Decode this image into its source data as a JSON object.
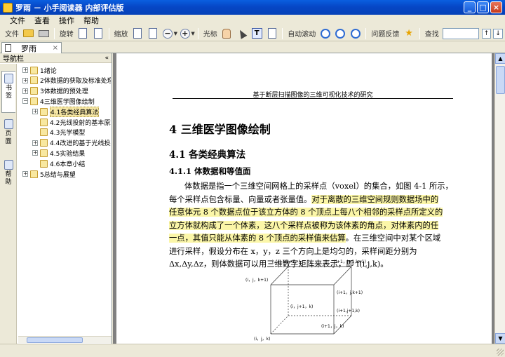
{
  "window": {
    "title": "罗雨 － 小手阅读器 内部评估版",
    "minimize": "_",
    "maximize": "□",
    "close": "×"
  },
  "menu": [
    "文件",
    "查看",
    "操作",
    "帮助"
  ],
  "toolbar": {
    "file_label": "文件",
    "rotate_label": "旋转",
    "zoom_label": "缩放",
    "zoom_out": "−",
    "zoom_in": "+",
    "cursor_label": "光标",
    "text_tool": "T",
    "autoscroll_label": "自动滚动",
    "feedback_label": "问题反馈",
    "find_label": "查找",
    "find_value": "",
    "find_prev": "↑",
    "find_next": "↓"
  },
  "doc_tab": {
    "label": "罗雨",
    "close": "×"
  },
  "sidebar": {
    "title": "导航栏",
    "collapse": "«",
    "vtabs": [
      "书签",
      "页面",
      "帮助"
    ],
    "tree": [
      {
        "label": "1绪论",
        "level": 0,
        "expander": "+"
      },
      {
        "label": "2体数据的获取及标准处理",
        "level": 0,
        "expander": "+"
      },
      {
        "label": "3体数据的预处理",
        "level": 0,
        "expander": "+"
      },
      {
        "label": "4三维医学图像绘制",
        "level": 0,
        "expander": "−"
      },
      {
        "label": "4.1各类经典算法",
        "level": 1,
        "expander": "+",
        "selected": true
      },
      {
        "label": "4.2光线投射的基本原理",
        "level": 1,
        "expander": ""
      },
      {
        "label": "4.3光学模型",
        "level": 1,
        "expander": ""
      },
      {
        "label": "4.4改进的基于光线投射的",
        "level": 1,
        "expander": "+"
      },
      {
        "label": "4.5实验结果",
        "level": 1,
        "expander": "+"
      },
      {
        "label": "4.6本章小结",
        "level": 1,
        "expander": ""
      },
      {
        "label": "5总结与展望",
        "level": 0,
        "expander": "+"
      }
    ]
  },
  "document": {
    "running_head": "基于断层扫描图像的三维可视化技术的研究",
    "chapter_title": "4 三维医学图像绘制",
    "section_title": "4.1 各类经典算法",
    "subsection_title": "4.1.1 体数据和等值面",
    "lines": [
      [
        {
          "t": "体数据是指一个三维空间网格上的采样点（voxel）的集合，如图 4-1 所示，",
          "hl": false
        }
      ],
      [
        {
          "t": "每个采样点包含标量、向量或者张量值。",
          "hl": false
        },
        {
          "t": "对于离散的三维空间规则数据场中的",
          "hl": true
        }
      ],
      [
        {
          "t": "任意体元 8 个数据点位于该立方体的 8 个顶点上每八个相邻的采样点所定义的",
          "hl": true
        }
      ],
      [
        {
          "t": "立方体就构成了一个体素，这八个采样点被称为该体素的角点，对体素内的任",
          "hl": true
        }
      ],
      [
        {
          "t": "一点，其值只能从体素的 8 个顶点的采样值来估算",
          "hl": true
        },
        {
          "t": "。在三维空间中对某个区域",
          "hl": false
        }
      ],
      [
        {
          "t": "进行采样，假设分布在 x，y，z 三个方向上是均匀的，采样间距分别为",
          "hl": false
        }
      ],
      [
        {
          "t": "Δx,Δy,Δz，则体数据可以用三维数字矩阵来表示，即 f(i,j,k)。",
          "hl": false
        }
      ]
    ],
    "figure_labels": [
      "i，j+1,k+1",
      "(i+1，j+1,k+1)",
      "(i，j，k+1)",
      "(i+1，j,k+1)",
      "(i，j+1，k)",
      "(i+1,j+1,k)",
      "(i+1，j，k)",
      "(i，j，k)"
    ]
  }
}
